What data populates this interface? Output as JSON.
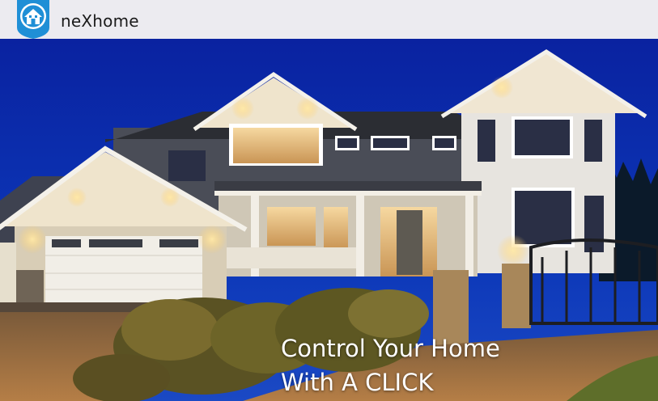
{
  "app": {
    "name": "neXhome",
    "logo_icon": "house-shield-icon"
  },
  "hero": {
    "image": "illuminated-house-at-night",
    "headline_line1": "Control Your Home",
    "headline_line2": "With A CLICK"
  },
  "colors": {
    "titlebar_bg": "#ecebf0",
    "logo_blue": "#1f8fd6",
    "sky": "#0b2a8a"
  }
}
